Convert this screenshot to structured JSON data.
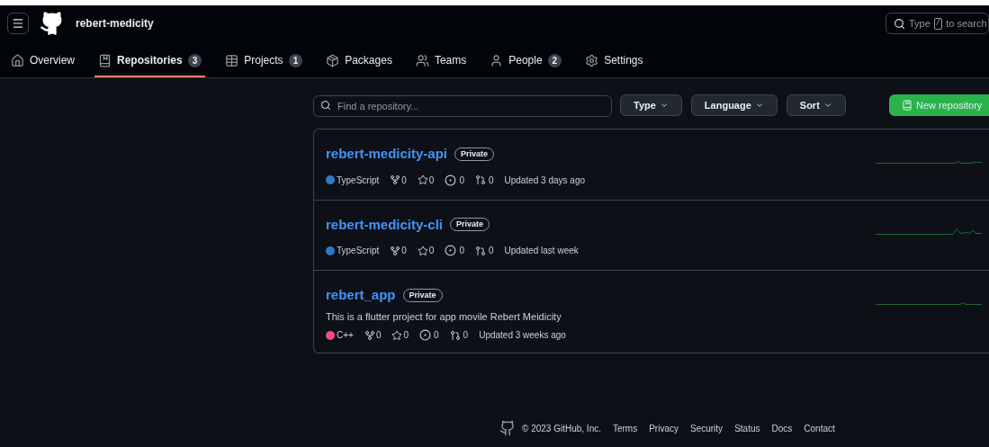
{
  "header": {
    "org": "rebert-medicity",
    "search": {
      "prefix": "Type",
      "key": "/",
      "suffix": "to search"
    }
  },
  "tabs": [
    {
      "label": "Overview",
      "selected": false
    },
    {
      "label": "Repositories",
      "count": "3",
      "selected": true
    },
    {
      "label": "Projects",
      "count": "1",
      "selected": false
    },
    {
      "label": "Packages",
      "selected": false
    },
    {
      "label": "Teams",
      "selected": false
    },
    {
      "label": "People",
      "count": "2",
      "selected": false
    },
    {
      "label": "Settings",
      "selected": false
    }
  ],
  "filter": {
    "placeholder": "Find a repository...",
    "dropdowns": [
      "Type",
      "Language",
      "Sort"
    ],
    "new_button": "New repository"
  },
  "repositories": [
    {
      "name": "rebert-medicity-api",
      "visibility": "Private",
      "language": "TypeScript",
      "color": "#3178c6",
      "forks": "0",
      "stars": "0",
      "issues": "0",
      "pulls": "0",
      "updated": "Updated 3 days ago"
    },
    {
      "name": "rebert-medicity-cli",
      "visibility": "Private",
      "language": "TypeScript",
      "color": "#3178c6",
      "forks": "0",
      "stars": "0",
      "issues": "0",
      "pulls": "0",
      "updated": "Updated last week"
    },
    {
      "name": "rebert_app",
      "visibility": "Private",
      "description": "This is a flutter project for app movile Rebert Meidicity",
      "language": "C++",
      "color": "#f34b7d",
      "forks": "0",
      "stars": "0",
      "issues": "0",
      "pulls": "0",
      "updated": "Updated 3 weeks ago"
    }
  ],
  "footer": {
    "copyright": "© 2023 GitHub, Inc.",
    "links": [
      "Terms",
      "Privacy",
      "Security",
      "Status",
      "Docs",
      "Contact"
    ]
  }
}
